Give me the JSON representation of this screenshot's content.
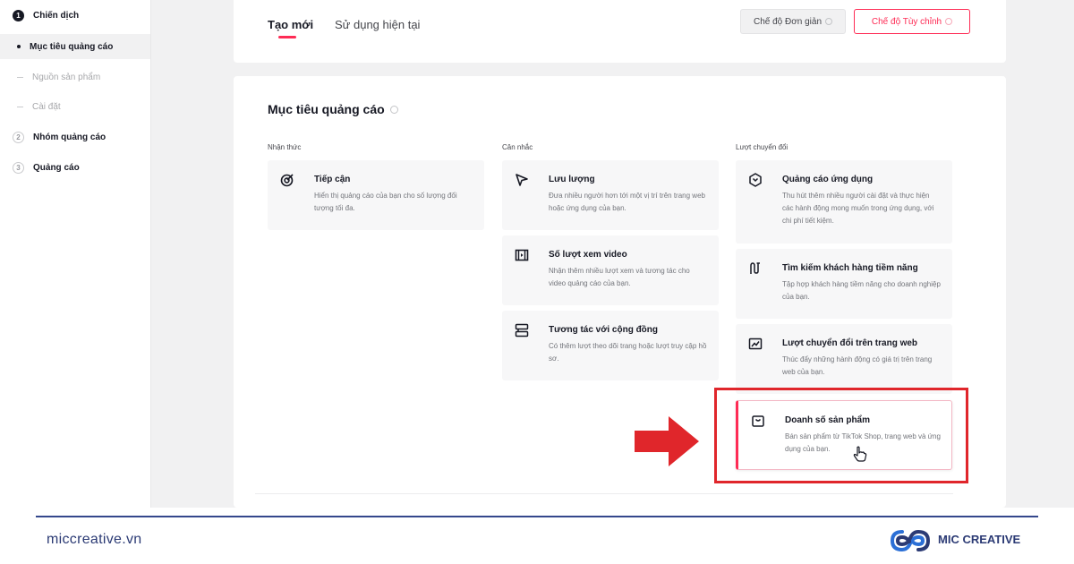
{
  "sidebar": {
    "steps": [
      {
        "num": "1",
        "label": "Chiến dịch"
      },
      {
        "num": "2",
        "label": "Nhóm quảng cáo"
      },
      {
        "num": "3",
        "label": "Quảng cáo"
      }
    ],
    "substeps": [
      "Mục tiêu quảng cáo",
      "Nguồn sản phẩm",
      "Cài đặt"
    ]
  },
  "header": {
    "tabs": [
      "Tạo mới",
      "Sử dụng hiện tại"
    ],
    "mode_simple": "Chế độ Đơn giản",
    "mode_custom": "Chế độ Tùy chỉnh"
  },
  "main": {
    "title": "Mục tiêu quảng cáo",
    "columns": [
      "Nhận thức",
      "Cân nhắc",
      "Lượt chuyển đổi"
    ],
    "objectives": {
      "reach": {
        "title": "Tiếp cận",
        "desc": "Hiển thị quảng cáo của bạn cho số lượng đối tượng tối đa.",
        "icon": "target-icon"
      },
      "traffic": {
        "title": "Lưu lượng",
        "desc": "Đưa nhiều người hơn tới một vị trí trên trang web hoặc ứng dụng của bạn.",
        "icon": "cursor-arrow-icon"
      },
      "video_views": {
        "title": "Số lượt xem video",
        "desc": "Nhận thêm nhiều lượt xem và tương tác cho video quảng cáo của bạn.",
        "icon": "video-icon"
      },
      "community": {
        "title": "Tương tác với cộng đồng",
        "desc": "Có thêm lượt theo dõi trang hoặc lượt truy cập hồ sơ.",
        "icon": "community-icon"
      },
      "app_promotion": {
        "title": "Quảng cáo ứng dụng",
        "desc": "Thu hút thêm nhiều người cài đặt và thực hiện các hành động mong muốn trong ứng dụng, với chi phí tiết kiệm.",
        "icon": "app-icon"
      },
      "lead_gen": {
        "title": "Tìm kiếm khách hàng tiềm năng",
        "desc": "Tập hợp khách hàng tiềm năng cho doanh nghiệp của bạn.",
        "icon": "funnel-icon"
      },
      "web_conversions": {
        "title": "Lượt chuyển đổi trên trang web",
        "desc": "Thúc đẩy những hành động có giá trị trên trang web của bạn.",
        "icon": "chart-icon"
      },
      "product_sales": {
        "title": "Doanh số sản phẩm",
        "desc": "Bán sản phẩm từ TikTok Shop, trang web và ứng dụng của bạn.",
        "icon": "shopping-bag-icon"
      }
    }
  },
  "footer": {
    "website": "miccreative.vn",
    "brand": "MIC CREATIVE"
  },
  "colors": {
    "accent": "#fe2c55",
    "highlight": "#e0262b",
    "footer": "#2b3a74"
  }
}
